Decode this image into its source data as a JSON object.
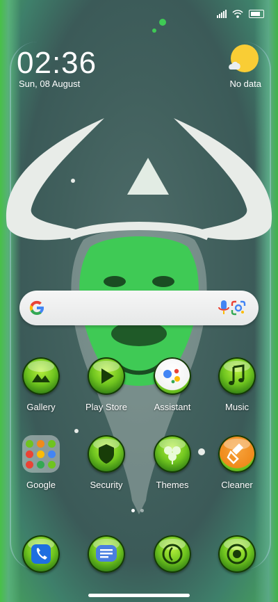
{
  "status_bar": {
    "icons": [
      "signal-icon",
      "wifi-icon",
      "battery-icon"
    ]
  },
  "lock_widget": {
    "time": "02:36",
    "date": "Sun, 08 August"
  },
  "weather": {
    "icon": "sun-cloud-icon",
    "text": "No data"
  },
  "search_bar": {
    "icons": [
      "google-g-icon",
      "microphone-icon",
      "google-lens-icon"
    ]
  },
  "apps_row1": [
    {
      "label": "Gallery",
      "icon": "gallery-icon"
    },
    {
      "label": "Play Store",
      "icon": "play-store-icon"
    },
    {
      "label": "Assistant",
      "icon": "assistant-icon"
    },
    {
      "label": "Music",
      "icon": "music-icon"
    }
  ],
  "apps_row2": [
    {
      "label": "Google",
      "icon": "google-folder-icon"
    },
    {
      "label": "Security",
      "icon": "security-icon"
    },
    {
      "label": "Themes",
      "icon": "themes-icon"
    },
    {
      "label": "Cleaner",
      "icon": "cleaner-icon"
    }
  ],
  "dock": [
    {
      "icon": "phone-icon"
    },
    {
      "icon": "messages-icon"
    },
    {
      "icon": "browser-icon"
    },
    {
      "icon": "camera-icon"
    }
  ],
  "page_indicator": {
    "pages": 2,
    "current": 1
  },
  "colors": {
    "accent_green": "#6fc41f",
    "assistant_blue": "#4285f4",
    "cleaner_orange": "#f08a1c"
  }
}
